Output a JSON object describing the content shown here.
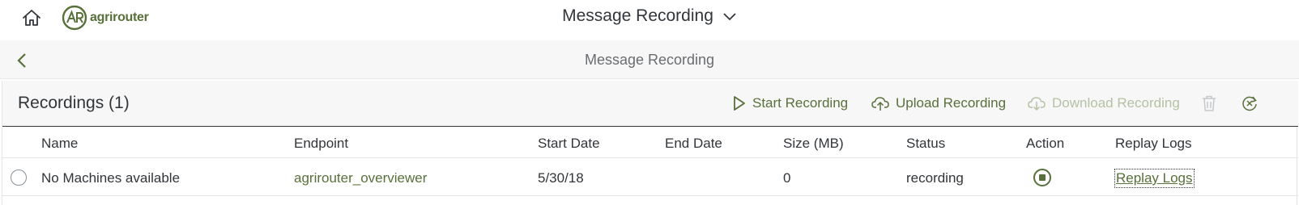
{
  "shell": {
    "logo_text": "agrirouter",
    "title": "Message Recording"
  },
  "page": {
    "title": "Message Recording"
  },
  "toolbar": {
    "title": "Recordings (1)",
    "start_label": "Start Recording",
    "upload_label": "Upload Recording",
    "download_label": "Download Recording"
  },
  "table": {
    "columns": {
      "name": "Name",
      "endpoint": "Endpoint",
      "start_date": "Start Date",
      "end_date": "End Date",
      "size": "Size (MB)",
      "status": "Status",
      "action": "Action",
      "replay_logs": "Replay Logs"
    },
    "rows": [
      {
        "name": "No Machines available",
        "endpoint": "agrirouter_overviewer",
        "start_date": "5/30/18",
        "end_date": "",
        "size": "0",
        "status": "recording",
        "replay_logs": "Replay Logs"
      }
    ]
  },
  "colors": {
    "accent": "#58703a",
    "accent_disabled": "#b4c2a4",
    "text": "#32363a",
    "header_bg": "#f7f7f7"
  },
  "icons": {
    "home": "home-icon",
    "dropdown": "chevron-down-icon",
    "back": "chevron-left-icon",
    "start": "play-icon",
    "upload": "cloud-upload-icon",
    "download": "cloud-download-icon",
    "delete": "trash-icon",
    "clear": "clear-filter-icon",
    "stop": "stop-icon"
  }
}
